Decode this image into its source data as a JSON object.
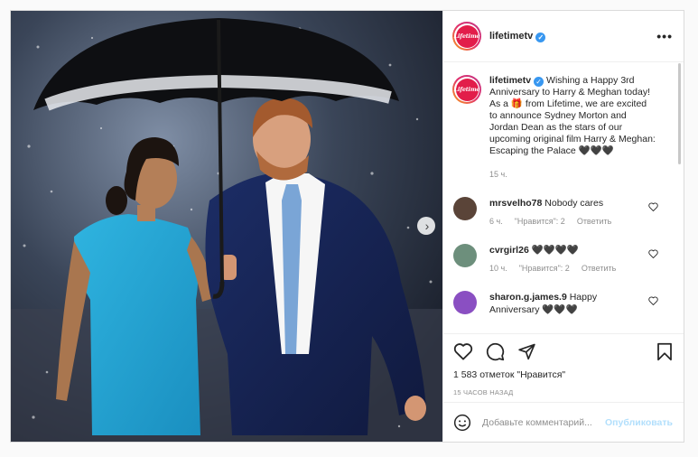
{
  "post": {
    "account": {
      "username": "lifetimetv",
      "verified": true,
      "avatar_text": "Lifetime",
      "avatar_color": "#e21d4a"
    },
    "more_icon": "ellipsis-icon",
    "more_label": "•••",
    "image_alt": "Harry and Meghan smiling under a black umbrella in the rain",
    "next_icon": "chevron-right-icon",
    "next_label": "›",
    "caption": {
      "username": "lifetimetv",
      "text": "Wishing a Happy 3rd Anniversary to Harry & Meghan today! As a 🎁 from Lifetime, we are excited to announce Sydney Morton and Jordan Dean as the stars of our upcoming original film Harry & Meghan: Escaping the Palace 🖤🖤🖤",
      "time": "15 ч."
    },
    "comments": [
      {
        "username": "mrsvelho78",
        "text": "Nobody cares",
        "time": "6 ч.",
        "likes": "\"Нравится\": 2",
        "reply": "Ответить",
        "avatar_color": "#5a4438"
      },
      {
        "username": "cvrgirl26",
        "text": "🖤🖤🖤🖤",
        "time": "10 ч.",
        "likes": "\"Нравится\": 2",
        "reply": "Ответить",
        "avatar_color": "#6d8f7c"
      },
      {
        "username": "sharon.g.james.9",
        "text": "Happy Anniversary 🖤🖤🖤",
        "time": "",
        "likes": "",
        "reply": "",
        "avatar_color": "#8a4fc2"
      }
    ],
    "actions": {
      "like_icon": "heart-icon",
      "comment_icon": "comment-icon",
      "share_icon": "paper-plane-icon",
      "save_icon": "bookmark-icon"
    },
    "likes_text": "1 583 отметок \"Нравится\"",
    "posted_ago": "15 ЧАСОВ НАЗАД",
    "add_comment": {
      "placeholder": "Добавьте комментарий...",
      "emoji_icon": "smiley-icon",
      "publish_label": "Опубликовать",
      "publish_color": "#b2dffc"
    }
  }
}
